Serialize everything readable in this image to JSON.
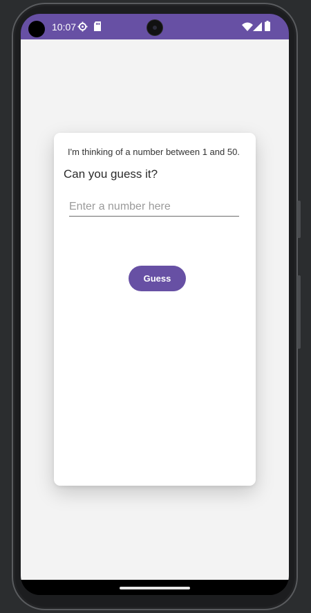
{
  "status_bar": {
    "time": "10:07",
    "background_color": "#6750a4",
    "icons": [
      "settings-gear-icon",
      "sd-card-icon",
      "wifi-icon",
      "cellular-signal-icon",
      "battery-icon"
    ]
  },
  "game": {
    "intro_text": "I'm thinking of a number between 1 and 50.",
    "question_text": "Can you guess it?",
    "input_placeholder": "Enter a number here",
    "input_value": "",
    "guess_button_label": "Guess",
    "accent_color": "#6750a4"
  }
}
